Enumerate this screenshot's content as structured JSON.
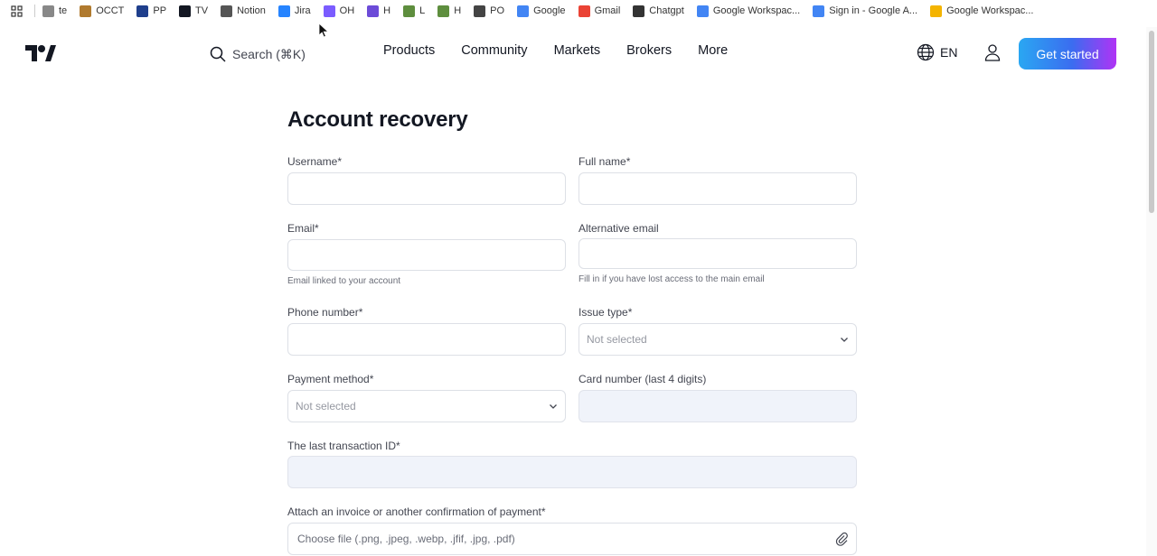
{
  "bookmarks": [
    {
      "label": "te",
      "icon": "pencil-icon",
      "color": "#888888"
    },
    {
      "label": "OCCT",
      "icon": "box-icon",
      "color": "#b07a2e"
    },
    {
      "label": "PP",
      "icon": "paypal-icon",
      "color": "#1f3f8c"
    },
    {
      "label": "TV",
      "icon": "tradingview-icon",
      "color": "#131722"
    },
    {
      "label": "Notion",
      "icon": "home-icon",
      "color": "#555555"
    },
    {
      "label": "Jira",
      "icon": "jira-icon",
      "color": "#2684ff"
    },
    {
      "label": "OH",
      "icon": "circle-icon",
      "color": "#7b5cff"
    },
    {
      "label": "H",
      "icon": "s-icon",
      "color": "#6c4bd8"
    },
    {
      "label": "L",
      "icon": "shopify-icon",
      "color": "#5e8e3e"
    },
    {
      "label": "H",
      "icon": "shopify-icon",
      "color": "#5e8e3e"
    },
    {
      "label": "PO",
      "icon": "globe-icon",
      "color": "#444444"
    },
    {
      "label": "Google",
      "icon": "google-icon",
      "color": "#4285f4"
    },
    {
      "label": "Gmail",
      "icon": "gmail-icon",
      "color": "#ea4335"
    },
    {
      "label": "Chatgpt",
      "icon": "openai-icon",
      "color": "#333333"
    },
    {
      "label": "Google Workspac...",
      "icon": "google-icon",
      "color": "#4285f4"
    },
    {
      "label": "Sign in - Google A...",
      "icon": "google-icon",
      "color": "#4285f4"
    },
    {
      "label": "Google Workspac...",
      "icon": "slides-icon",
      "color": "#f4b400"
    }
  ],
  "header": {
    "search_label": "Search (⌘K)",
    "nav": [
      "Products",
      "Community",
      "Markets",
      "Brokers",
      "More"
    ],
    "language": "EN",
    "cta": "Get started"
  },
  "form": {
    "title": "Account recovery",
    "username_label": "Username*",
    "fullname_label": "Full name*",
    "email_label": "Email*",
    "email_hint": "Email linked to your account",
    "alt_email_label": "Alternative email",
    "alt_email_hint": "Fill in if you have lost access to the main email",
    "phone_label": "Phone number*",
    "issue_label": "Issue type*",
    "issue_value": "Not selected",
    "payment_label": "Payment method*",
    "payment_value": "Not selected",
    "card_label": "Card number (last 4 digits)",
    "transaction_label": "The last transaction ID*",
    "attach_label": "Attach an invoice or another confirmation of payment*",
    "attach_placeholder": "Choose file (.png, .jpeg, .webp, .jfif, .jpg, .pdf)"
  }
}
